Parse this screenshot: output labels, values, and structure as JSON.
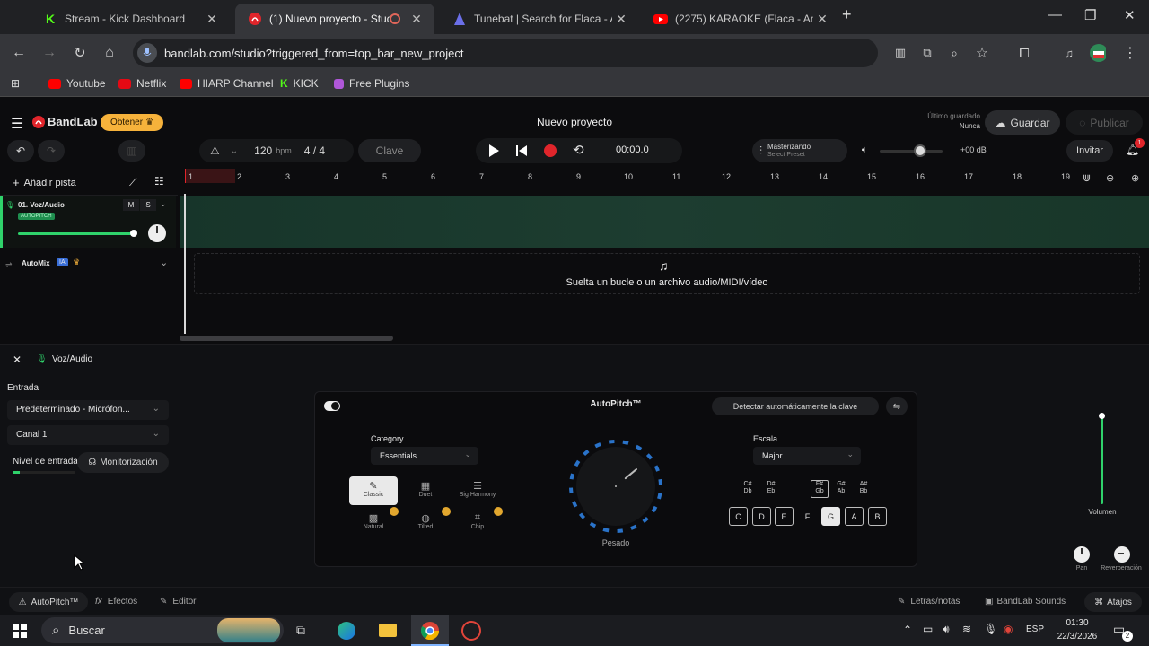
{
  "browser": {
    "tabs": [
      {
        "title": "Stream - Kick Dashboard",
        "active": false
      },
      {
        "title": "(1) Nuevo proyecto - Studio",
        "active": true
      },
      {
        "title": "Tunebat | Search for Flaca - An",
        "active": false
      },
      {
        "title": "(2275) KARAOKE (Flaca - Andr",
        "active": false
      }
    ],
    "url": "bandlab.com/studio?triggered_from=top_bar_new_project",
    "bookmarks": [
      "Youtube",
      "Netflix",
      "HIARP Channel",
      "KICK",
      "Free Plugins"
    ]
  },
  "topbar": {
    "brand": "BandLab",
    "get_button": "Obtener",
    "project_title": "Nuevo proyecto",
    "last_saved_label": "Último guardado",
    "last_saved_value": "Nunca",
    "save_button": "Guardar",
    "publish_button": "Publicar"
  },
  "transport": {
    "tempo": "120",
    "tempo_unit": "bpm",
    "time_signature": "4 / 4",
    "key_button": "Clave",
    "time": "00:00.0",
    "mastering_title": "Masterizando",
    "mastering_sub": "Select Preset",
    "volume_db": "+00 dB",
    "invite_button": "Invitar",
    "notification_count": "1"
  },
  "tracks": {
    "add_track": "Añadir pista",
    "track1_name": "01. Voz/Audio",
    "track1_badge": "AUTOPITCH",
    "mute": "M",
    "solo": "S",
    "automix_label": "AutoMix",
    "automix_badge": "IA",
    "drop_hint": "Suelta un bucle o un archivo audio/MIDI/vídeo"
  },
  "ruler": [
    "1",
    "2",
    "3",
    "4",
    "5",
    "6",
    "7",
    "8",
    "9",
    "10",
    "11",
    "12",
    "13",
    "14",
    "15",
    "16",
    "17",
    "18",
    "19"
  ],
  "bottom_panel": {
    "track_name": "Voz/Audio",
    "input_label": "Entrada",
    "input_value": "Predeterminado - Micrófon...",
    "channel_value": "Canal 1",
    "input_level_label": "Nivel de entrada",
    "monitoring_button": "Monitorización",
    "volume_label": "Volumen",
    "pan_label": "Pan",
    "reverb_label": "Reverberación"
  },
  "autopitch": {
    "title": "AutoPitch™",
    "detect_key_button": "Detectar automáticamente la clave",
    "category_label": "Category",
    "category_value": "Essentials",
    "presets": [
      "Classic",
      "Duet",
      "Big Harmony",
      "Natural",
      "Tilted",
      "Chip"
    ],
    "knob_label": "Pesado",
    "scale_label": "Escala",
    "scale_value": "Major",
    "black_keys": [
      {
        "top": "C#",
        "bottom": "Db"
      },
      {
        "top": "D#",
        "bottom": "Eb"
      },
      {
        "top": "F#",
        "bottom": "Gb"
      },
      {
        "top": "G#",
        "bottom": "Ab"
      },
      {
        "top": "A#",
        "bottom": "Bb"
      }
    ],
    "white_keys": [
      "C",
      "D",
      "E",
      "F",
      "G",
      "A",
      "B"
    ]
  },
  "footer_tabs": {
    "autopitch": "AutoPitch™",
    "effects": "Efectos",
    "editor": "Editor",
    "lyrics": "Letras/notas",
    "sounds": "BandLab Sounds",
    "shortcuts": "Atajos"
  },
  "taskbar": {
    "search_placeholder": "Buscar",
    "lang": "ESP",
    "time": "01:30",
    "date": "22/3/2026",
    "notifications": "2"
  },
  "colors": {
    "accent_red": "#e0252b",
    "brand_orange": "#f6b23b",
    "track_green": "#2fd26b",
    "lane_green": "#1a3a2c"
  }
}
